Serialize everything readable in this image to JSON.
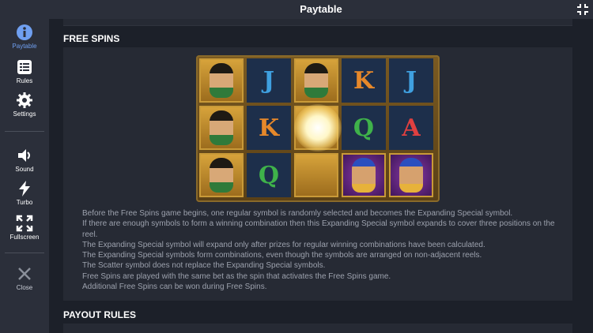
{
  "header": {
    "title": "Paytable"
  },
  "sidebar": {
    "items": [
      {
        "label": "Paytable",
        "icon": "info-icon",
        "active": true
      },
      {
        "label": "Rules",
        "icon": "list-icon"
      },
      {
        "label": "Settings",
        "icon": "gear-icon"
      },
      {
        "label": "Sound",
        "icon": "speaker-icon"
      },
      {
        "label": "Turbo",
        "icon": "lightning-icon"
      },
      {
        "label": "Fullscreen",
        "icon": "expand-icon"
      },
      {
        "label": "Close",
        "icon": "close-icon"
      }
    ]
  },
  "sections": {
    "free_spins": {
      "title": "FREE SPINS",
      "reels": [
        [
          "Cleopatra",
          "J",
          "Cleopatra",
          "K",
          "J"
        ],
        [
          "Cleopatra",
          "K",
          "",
          "Q",
          "A"
        ],
        [
          "Cleopatra",
          "Q",
          "",
          "Pharaoh",
          "Pharaoh"
        ]
      ],
      "paragraphs": [
        "Before the Free Spins game begins, one regular symbol is randomly selected and becomes the Expanding Special symbol.",
        "If there are enough symbols to form a winning combination then this Expanding Special symbol expands to cover three positions on the reel.",
        "The Expanding Special symbol will expand only after prizes for regular winning combinations have been calculated.",
        "The Expanding Special symbols form combinations, even though the symbols are arranged on non-adjacent reels.",
        "The Scatter symbol does not replace the Expanding Special symbols.",
        "Free Spins are played with the same bet as the spin that activates the Free Spins game.",
        "Additional Free Spins can be won during Free Spins."
      ]
    },
    "payout_rules": {
      "title": "PAYOUT RULES"
    }
  },
  "colors": {
    "accent_active": "#6f9ff0",
    "letter_blue": "#3fa0e0",
    "letter_orange": "#e6882a",
    "letter_green": "#3fb24a",
    "letter_red": "#e04040"
  }
}
